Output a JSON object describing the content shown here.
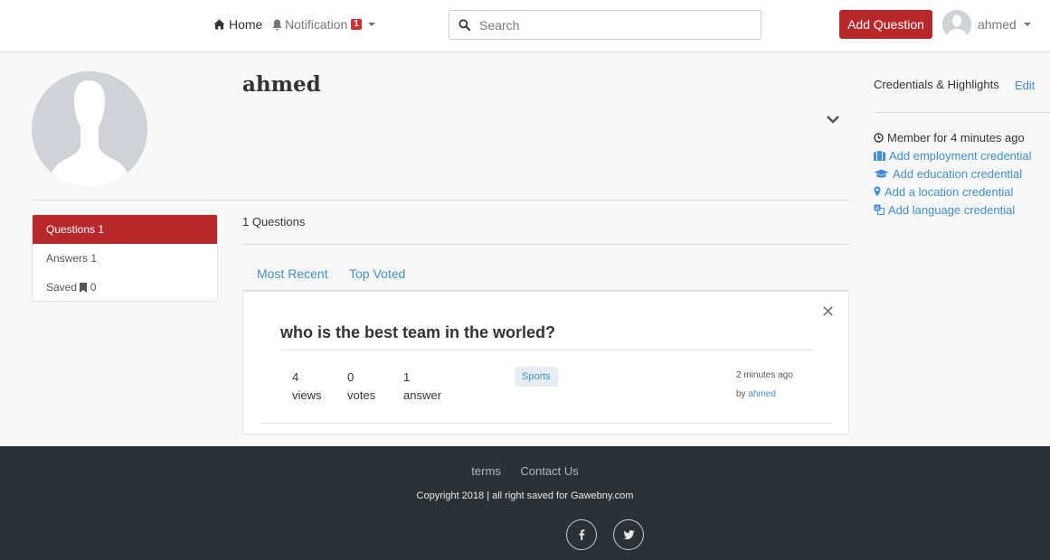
{
  "nav": {
    "home_label": "Home",
    "notification_label": "Notification",
    "notification_count": "1",
    "search_placeholder": "Search",
    "add_question_label": "Add Question",
    "user_name": "ahmed"
  },
  "profile": {
    "name": "ahmed"
  },
  "side_menu": [
    {
      "label": "Questions",
      "count": "1",
      "active": true
    },
    {
      "label": "Answers",
      "count": "1",
      "active": false
    },
    {
      "label": "Saved",
      "count": "0",
      "active": false
    }
  ],
  "main": {
    "questions_count_label": "1 Questions",
    "tabs": [
      "Most Recent",
      "Top Voted"
    ],
    "question": {
      "title": "who is the best team in the worled?",
      "views_value": "4",
      "views_label": "views",
      "votes_value": "0",
      "votes_label": "votes",
      "answers_value": "1",
      "answers_label": "answer",
      "tag": "Sports",
      "time": "2 minutes ago",
      "by_label": "by",
      "author": "ahmed"
    }
  },
  "credentials": {
    "title": "Credentials & Highlights",
    "edit_label": "Edit",
    "member_text": "Member for 4 minutes ago",
    "items": [
      {
        "label": "Add employment credential",
        "icon": "briefcase-icon"
      },
      {
        "label": "Add education credential",
        "icon": "graduation-cap-icon"
      },
      {
        "label": "Add a location credential",
        "icon": "map-marker-icon"
      },
      {
        "label": "Add language credential",
        "icon": "language-icon"
      }
    ]
  },
  "footer": {
    "links": [
      "terms",
      "Contact Us"
    ],
    "copyright": "Copyright 2018 | all right saved for Gawebny.com",
    "social": [
      "facebook-icon",
      "twitter-icon"
    ]
  },
  "colors": {
    "brand_red": "#b8282a",
    "link_blue": "#3f8fd2",
    "footer_bg": "#2b3237",
    "badge_red": "#d32f2f"
  }
}
